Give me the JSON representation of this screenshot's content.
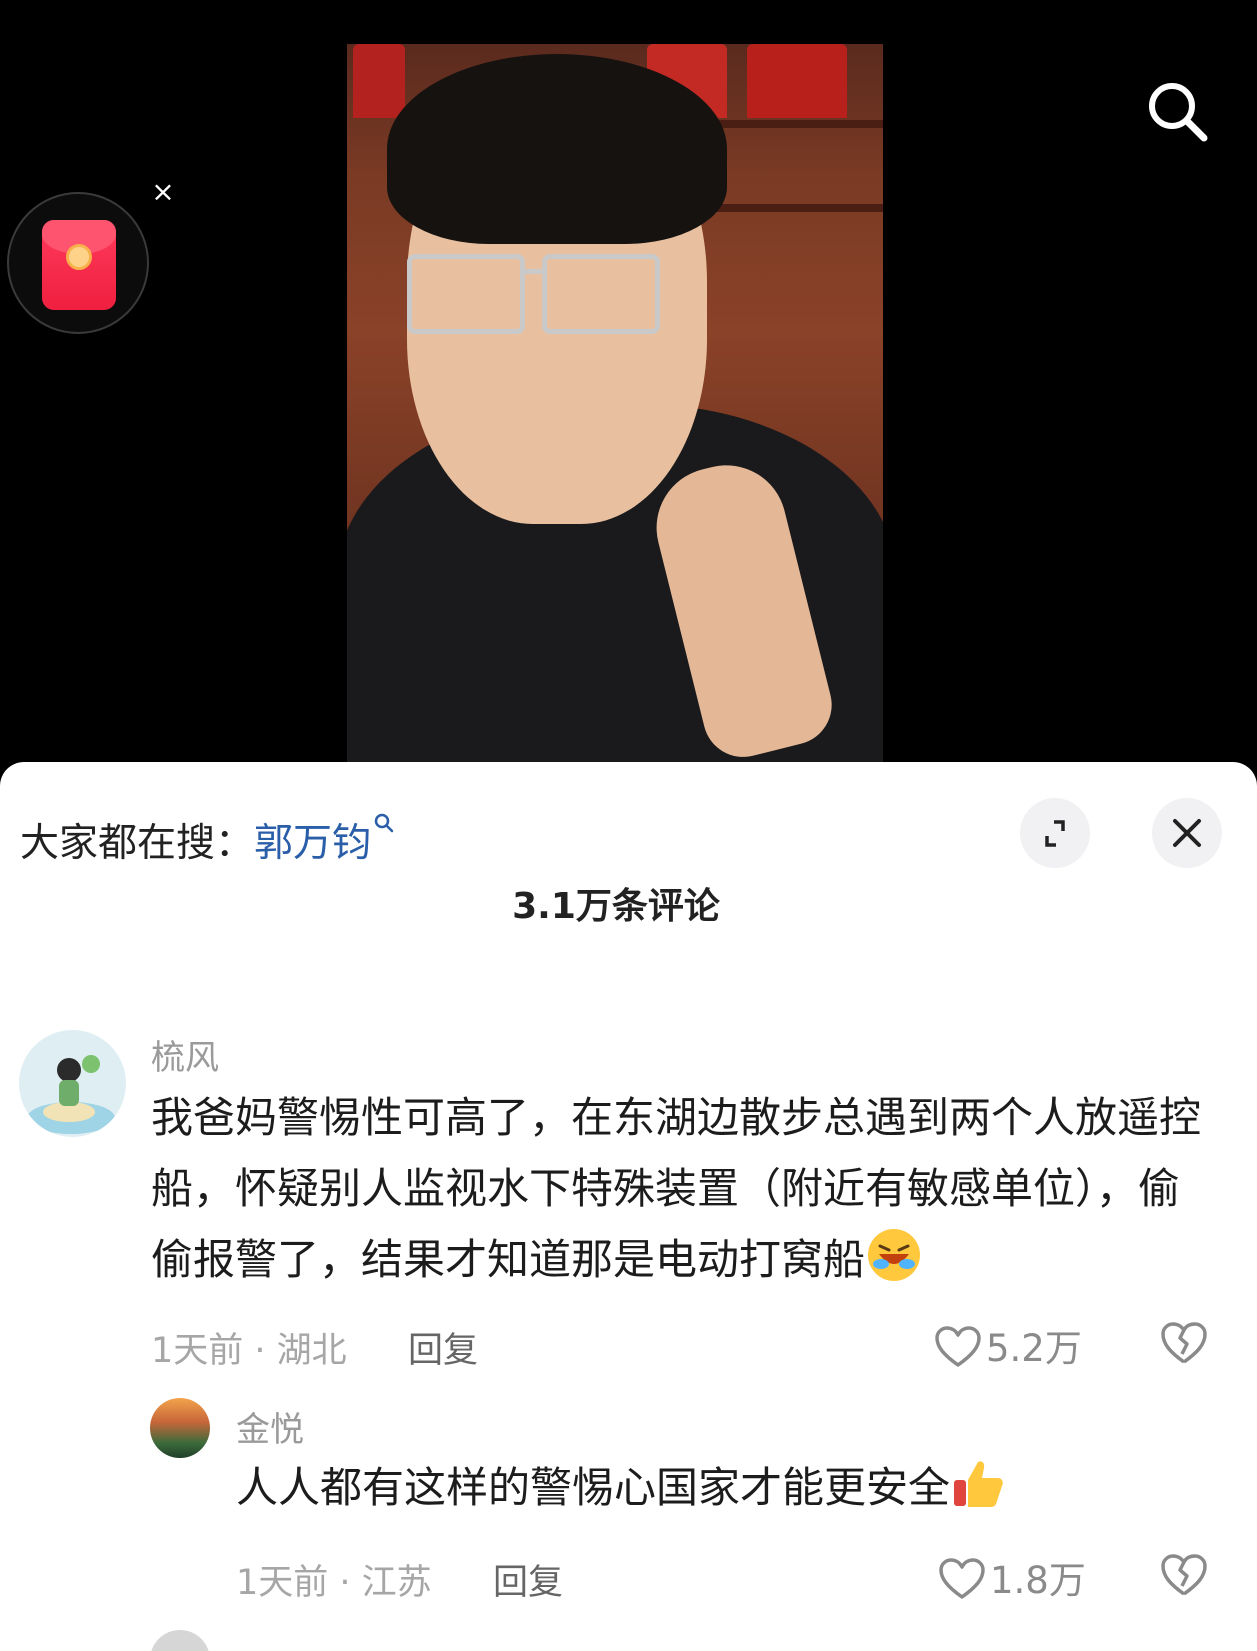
{
  "video": {
    "redpacket_close": "×",
    "search_icon": "search-icon"
  },
  "sheet": {
    "trending_label": "大家都在搜：",
    "trending_keyword": "郭万钧",
    "comment_count": "3.1万条评论"
  },
  "comments": [
    {
      "author": "梳风",
      "text": "我爸妈警惕性可高了，在东湖边散步总遇到两个人放遥控船，怀疑别人监视水下特殊装置（附近有敏感单位），偷偷报警了，结果才知道那是电动打窝船",
      "emoji": "rolling-laughing-emoji",
      "meta": "1天前 · 湖北",
      "reply_label": "回复",
      "likes": "5.2万"
    },
    {
      "author": "金悦",
      "text": "人人都有这样的警惕心国家才能更安全",
      "emoji": "thumbs-up-emoji",
      "meta": "1天前 · 江苏",
      "reply_label": "回复",
      "likes": "1.8万"
    }
  ],
  "colors": {
    "keyword_blue": "#2a5ea8",
    "red_packet": "#ef1f3f",
    "sheet_bg": "#ffffff"
  }
}
